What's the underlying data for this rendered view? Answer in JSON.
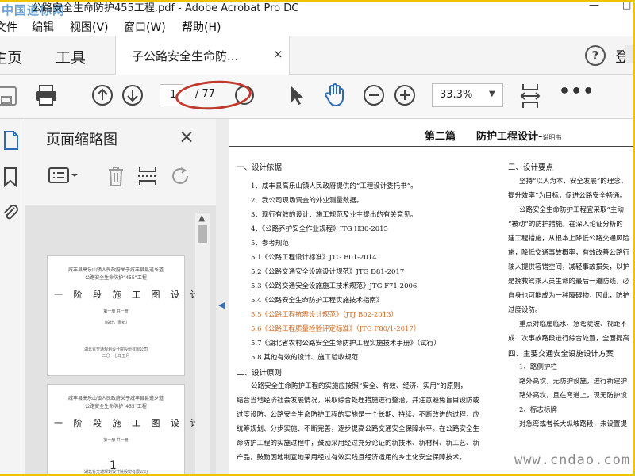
{
  "window": {
    "title": "公路安全生命防护455工程.pdf - Adobe Acrobat Pro DC",
    "watermark_top": "中国道标网",
    "minimize": "—",
    "maximize": "□"
  },
  "menu": [
    "文件",
    "编辑",
    "视图(V)",
    "窗口(W)",
    "帮助(H)"
  ],
  "tabs": {
    "home": "主页",
    "tools": "工具",
    "document": "子公路安全生命防...",
    "close": "×",
    "help": "?",
    "login": "登"
  },
  "toolbar": {
    "page_current": "1",
    "page_total": "/ 77",
    "zoom": "33.3%",
    "zoom_arrow": "▼",
    "more": "•••"
  },
  "thumbnail_panel": {
    "title": "页面缩略图",
    "close": "×",
    "pages": [
      {
        "label": "1",
        "lines": [
          "咸丰县高乐山镇人民政府关于咸丰县县道乡道",
          "公路安全生命防护“455”工程"
        ],
        "big": "一 阶 段 施 工 图 设 计",
        "small": [
          "第一册 共一册",
          "（设计、图纸）",
          "湖北省交通规划设计院股份有限公司",
          "二〇一七年五月"
        ]
      },
      {
        "lines": [
          "咸丰县高乐山镇人民政府关于咸丰县县道乡道",
          "公路安全生命防护“455”工程"
        ],
        "big": "一 阶 段 施 工 图 设 计",
        "small": [
          "第一册 共一册",
          "湖北省交通规划设计院股份有限公司"
        ]
      }
    ],
    "scroll_up": "▲"
  },
  "splitter_arrow": "◀",
  "document": {
    "title_main": "第二篇　　防护工程设计-",
    "title_sub": "说明书",
    "left_lines": [
      {
        "t": "一、设计依据",
        "style": "h"
      },
      {
        "t": "1、咸丰县高乐山镇人民政府提供的“工程设计委托书”。",
        "style": ""
      },
      {
        "t": "2、我公司现场调查的外业测量数据。",
        "style": ""
      },
      {
        "t": "3、现行有效的设计、施工规范及业主提出的有关意见。",
        "style": ""
      },
      {
        "t": "4、《公路养护安全作业规程》JTG H30-2015",
        "style": ""
      },
      {
        "t": "5、参考规范",
        "style": ""
      },
      {
        "t": "5.1《公路工程设计标准》JTG B01-2014",
        "style": ""
      },
      {
        "t": "5.2《公路交通安全设施设计规范》JTG D81-2017",
        "style": ""
      },
      {
        "t": "5.3《公路交通安全设施施工技术规范》JTG F71-2006",
        "style": ""
      },
      {
        "t": "5.4《公路安全生命防护工程实施技术指南》",
        "style": ""
      },
      {
        "t": "5.5《公路工程抗震设计规范》（JTJ B02-2013）",
        "style": "red"
      },
      {
        "t": "5.6《公路工程质量检验评定标准》（JTG F80/1-2017）",
        "style": "red"
      },
      {
        "t": "5.7《湖北省农村公路安全生命防护工程实施技术手册》（试行）",
        "style": ""
      },
      {
        "t": "5.8 其他有效的设计、施工验收规范",
        "style": ""
      },
      {
        "t": "二、设计原则",
        "style": "h"
      },
      {
        "t": "公路安全生命防护工程的实施应按照“安全、有效、经济、实用”的原则，",
        "style": ""
      },
      {
        "t": "结合当地经济社会发展情况，采取综合处理措施进行整治，并注意避免盲目设防或",
        "style": ""
      },
      {
        "t": "过度设防。公路安全生命防护工程的实施是一个长期、持续、不断改进的过程，应",
        "style": ""
      },
      {
        "t": "统筹规划、分步实施、不断完善，逐步提高公路交通安全保障水平。在公路安全生",
        "style": ""
      },
      {
        "t": "命防护工程的实施过程中，鼓励采用经过充分论证的新技术、新材料、新工艺、新",
        "style": ""
      },
      {
        "t": "产品，鼓励因地制宜地采用经过有效实践且经济适用的乡土化安全保障技术。",
        "style": ""
      }
    ],
    "right_lines": [
      {
        "t": "三、设计要点",
        "style": "h"
      },
      {
        "t": "坚持“以人为本、安全发展”的理念，",
        "style": ""
      },
      {
        "t": "提升效率”为目标，促进公路安全畅通。",
        "style": ""
      },
      {
        "t": "公路安全生命防护工程宜采取“主动",
        "style": ""
      },
      {
        "t": "“被动”的防护措施。在深入论证分析的",
        "style": ""
      },
      {
        "t": "建工程措施，从根本上降低公路交通风险",
        "style": ""
      },
      {
        "t": "施，降低交通事故概率，有效改善公路行",
        "style": ""
      },
      {
        "t": "驶人提供容错空间，减轻事故损失，以护",
        "style": ""
      },
      {
        "t": "是挽救驾乘人员生命的最后一道防线，必",
        "style": ""
      },
      {
        "t": "自身也可能成为一种障碍物，因此，防护",
        "style": ""
      },
      {
        "t": "过度设防。",
        "style": ""
      },
      {
        "t": "重点对临崖临水、急弯陡坡、视距不",
        "style": ""
      },
      {
        "t": "成二次事故路段进行综合处置，全面提高",
        "style": ""
      },
      {
        "t": "四、主要交通安全设施设计方案",
        "style": "h"
      },
      {
        "t": "1、路侧护栏",
        "style": ""
      },
      {
        "t": "路外高坎，无防护设施，进行新建护",
        "style": ""
      },
      {
        "t": "路外高坎，且在弯道上，现无防护设",
        "style": ""
      },
      {
        "t": "2、标志标牌",
        "style": ""
      },
      {
        "t": "对急弯或者长大纵坡路段，未设置提",
        "style": ""
      }
    ]
  },
  "watermark_bottom": "www.cndao.com"
}
